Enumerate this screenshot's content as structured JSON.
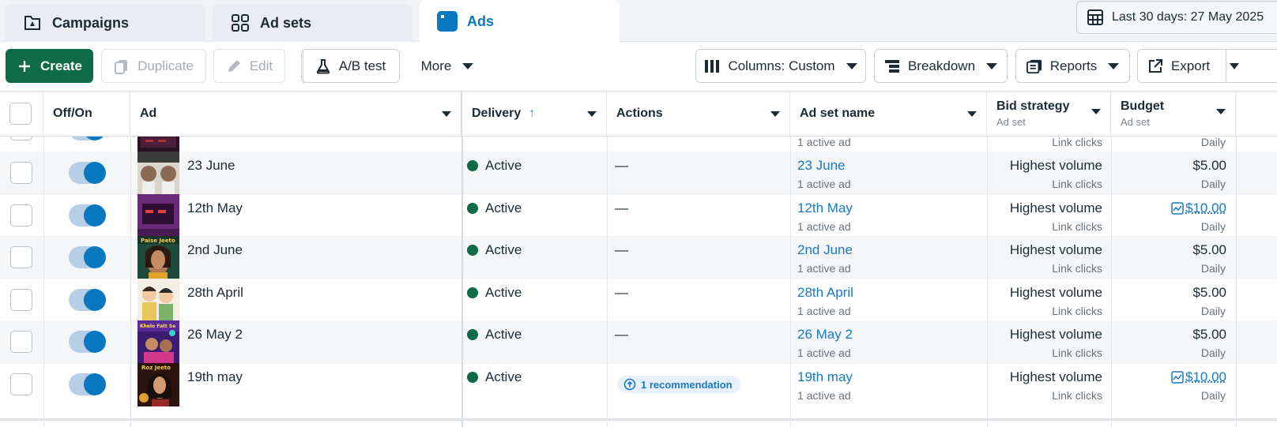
{
  "tabs": [
    {
      "label": "Campaigns",
      "icon": "campaign-flag-icon",
      "active": false
    },
    {
      "label": "Ad sets",
      "icon": "grid-icon",
      "active": false
    },
    {
      "label": "Ads",
      "icon": "ad-card-icon",
      "active": true
    }
  ],
  "date_range": {
    "label": "Last 30 days: 27 May 2025",
    "icon": "calendar-icon"
  },
  "toolbar": {
    "create": "Create",
    "duplicate": "Duplicate",
    "edit": "Edit",
    "ab_test": "A/B test",
    "more": "More",
    "columns": "Columns: Custom",
    "breakdown": "Breakdown",
    "reports": "Reports",
    "export": "Export"
  },
  "columns": {
    "off_on": "Off/On",
    "ad": "Ad",
    "delivery": "Delivery",
    "delivery_sort": "↑",
    "actions": "Actions",
    "ad_set_name": "Ad set name",
    "bid_strategy": "Bid strategy",
    "bid_strategy_sub": "Ad set",
    "budget": "Budget",
    "budget_sub": "Ad set"
  },
  "partial_row": {
    "ad_set_sub": "1 active ad",
    "bid_sub": "Link clicks",
    "budget_sub": "Daily"
  },
  "rows": [
    {
      "ad": "23 June",
      "delivery": "Active",
      "actions": "—",
      "ad_set": "23 June",
      "ad_set_sub": "1 active ad",
      "bid": "Highest volume",
      "bid_sub": "Link clicks",
      "budget": "$5.00",
      "budget_sub": "Daily",
      "budget_linked": false
    },
    {
      "ad": "12th May",
      "delivery": "Active",
      "actions": "—",
      "ad_set": "12th May",
      "ad_set_sub": "1 active ad",
      "bid": "Highest volume",
      "bid_sub": "Link clicks",
      "budget": "$10.00",
      "budget_sub": "Daily",
      "budget_linked": true
    },
    {
      "ad": "2nd June",
      "delivery": "Active",
      "actions": "—",
      "ad_set": "2nd June",
      "ad_set_sub": "1 active ad",
      "bid": "Highest volume",
      "bid_sub": "Link clicks",
      "budget": "$5.00",
      "budget_sub": "Daily",
      "budget_linked": false
    },
    {
      "ad": "28th April",
      "delivery": "Active",
      "actions": "—",
      "ad_set": "28th April",
      "ad_set_sub": "1 active ad",
      "bid": "Highest volume",
      "bid_sub": "Link clicks",
      "budget": "$5.00",
      "budget_sub": "Daily",
      "budget_linked": false
    },
    {
      "ad": "26 May 2",
      "delivery": "Active",
      "actions": "—",
      "ad_set": "26 May 2",
      "ad_set_sub": "1 active ad",
      "bid": "Highest volume",
      "bid_sub": "Link clicks",
      "budget": "$5.00",
      "budget_sub": "Daily",
      "budget_linked": false
    },
    {
      "ad": "19th may",
      "delivery": "Active",
      "actions": "1 recommendation",
      "ad_set": "19th may",
      "ad_set_sub": "1 active ad",
      "bid": "Highest volume",
      "bid_sub": "Link clicks",
      "budget": "$10.00",
      "budget_sub": "Daily",
      "budget_linked": true
    }
  ],
  "thumbnail_captions": {
    "row3": "Paise Jeeto",
    "row5": "Khelo Fatt Se",
    "row6": "Roz Jeeto"
  },
  "colors": {
    "active_green": "#0e6b47",
    "brand_blue": "#0a78be",
    "link_blue": "#1a78c2"
  }
}
